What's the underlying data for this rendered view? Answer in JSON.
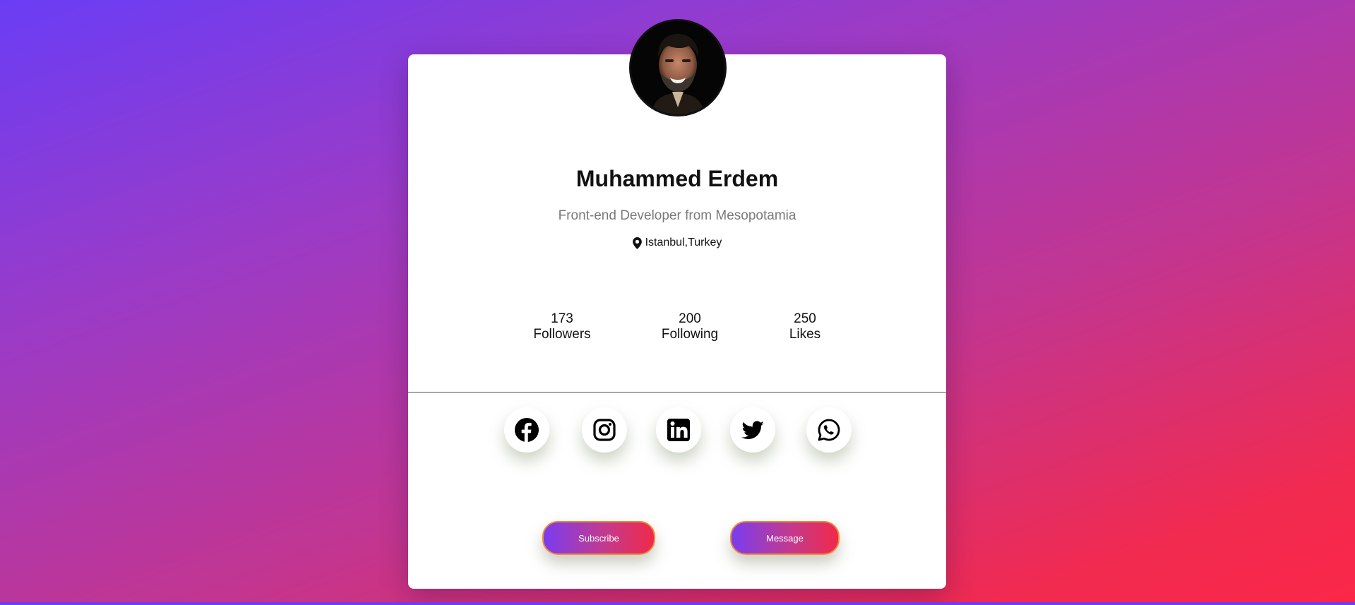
{
  "profile": {
    "name": "Muhammed Erdem",
    "tagline": "Front-end Developer from Mesopotamia",
    "location": "Istanbul,Turkey"
  },
  "stats": [
    {
      "value": "173",
      "label": "Followers"
    },
    {
      "value": "200",
      "label": "Following"
    },
    {
      "value": "250",
      "label": "Likes"
    }
  ],
  "social": [
    "facebook-icon",
    "instagram-icon",
    "linkedin-icon",
    "twitter-icon",
    "whatsapp-icon"
  ],
  "buttons": {
    "subscribe": "Subscribe",
    "message": "Message"
  },
  "colors": {
    "background_start": "#6a3df5",
    "background_end": "#fb2748",
    "button_gradient_start": "#7a3df0",
    "button_gradient_end": "#f02a4a",
    "button_border": "#f08a3a"
  }
}
